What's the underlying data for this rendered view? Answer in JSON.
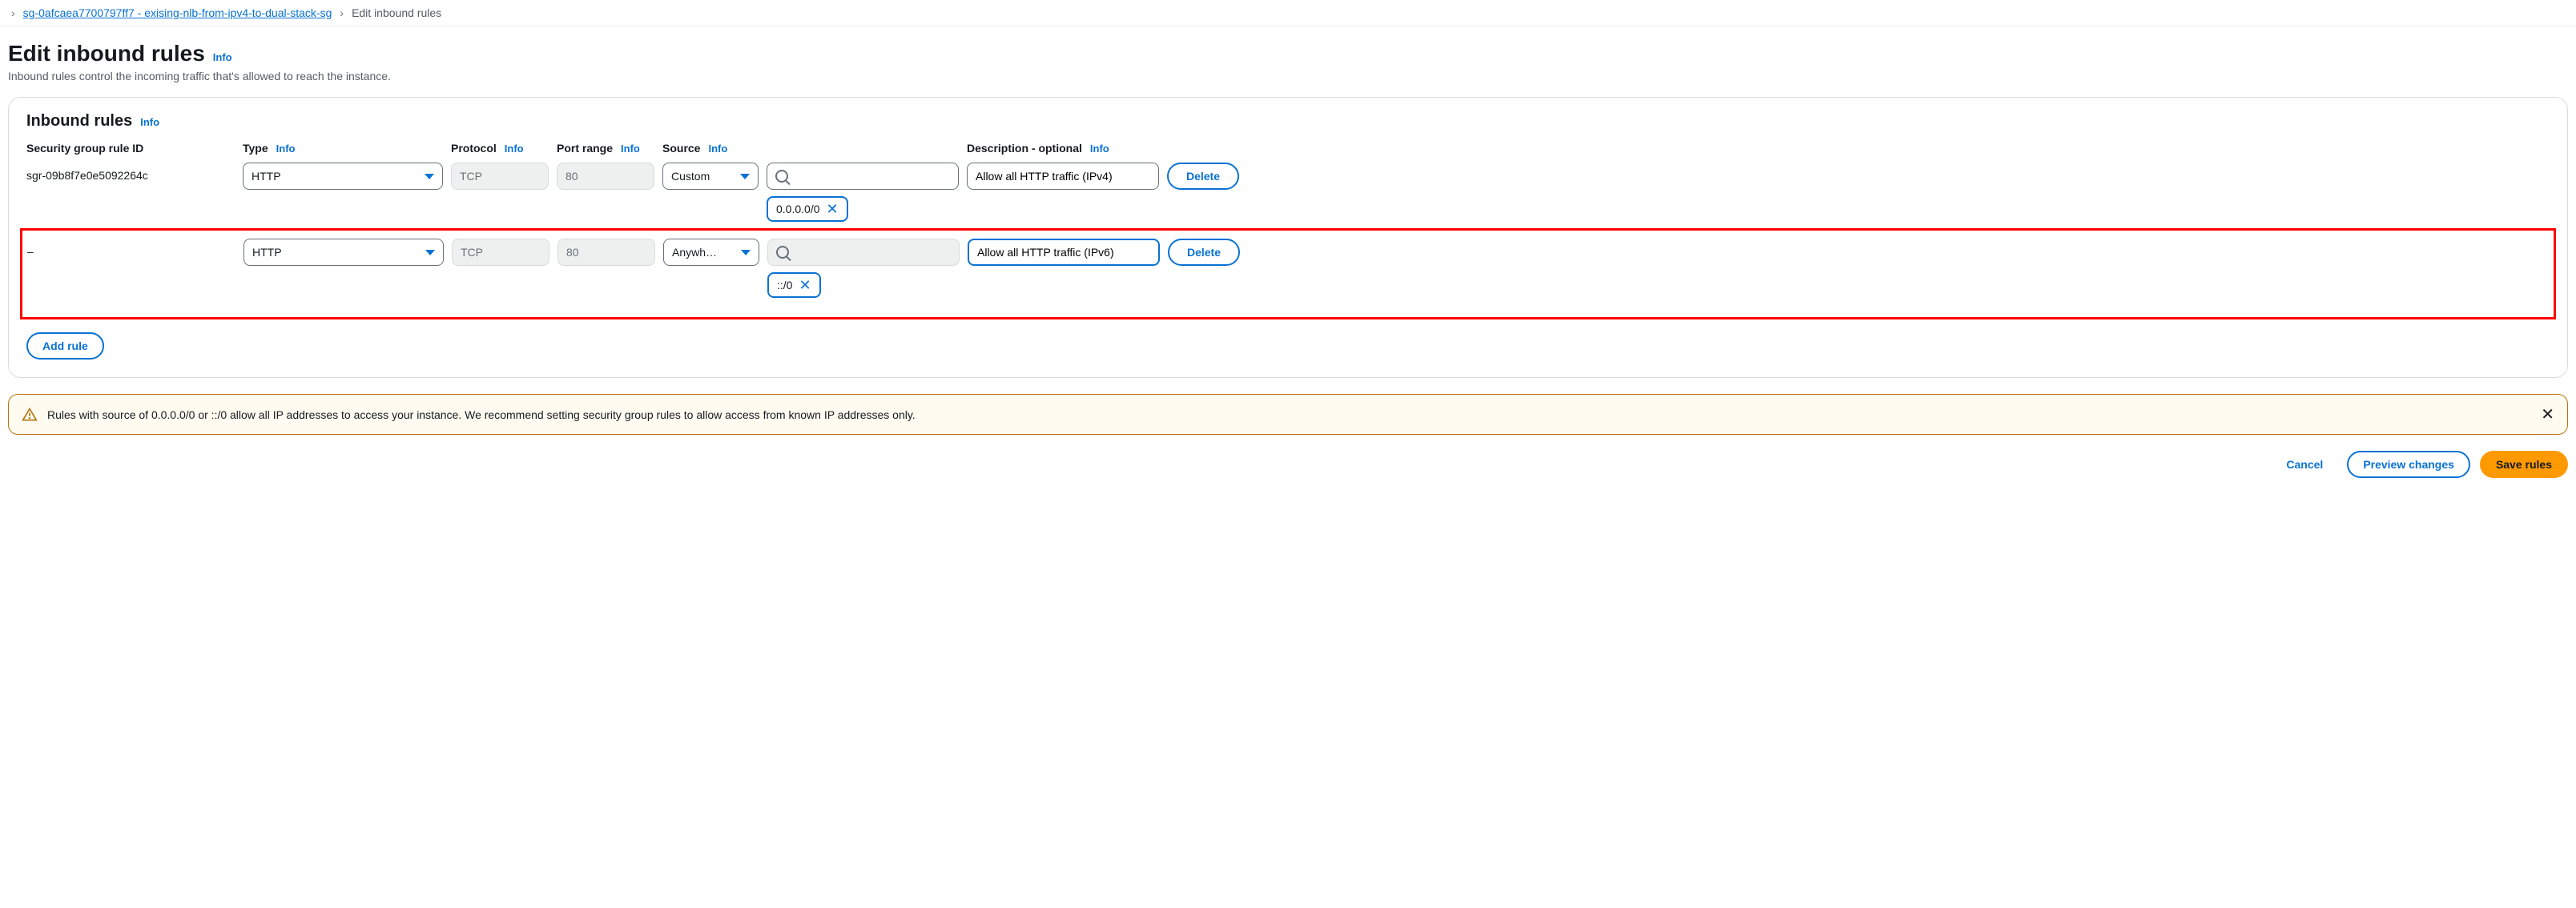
{
  "breadcrumb": {
    "link_text": "sg-0afcaea7700797ff7 - exising-nlb-from-ipv4-to-dual-stack-sg",
    "current": "Edit inbound rules"
  },
  "page": {
    "title": "Edit inbound rules",
    "info": "Info",
    "subtitle": "Inbound rules control the incoming traffic that's allowed to reach the instance."
  },
  "panel": {
    "title": "Inbound rules",
    "info": "Info",
    "headers": {
      "rule_id": "Security group rule ID",
      "type": "Type",
      "protocol": "Protocol",
      "port": "Port range",
      "source": "Source",
      "desc": "Description - optional",
      "info": "Info"
    },
    "rules": [
      {
        "id": "sgr-09b8f7e0e5092264c",
        "type": "HTTP",
        "protocol": "TCP",
        "port": "80",
        "source_mode": "Custom",
        "source_token": "0.0.0.0/0",
        "description": "Allow all HTTP traffic (IPv4)",
        "delete": "Delete"
      },
      {
        "id": "–",
        "type": "HTTP",
        "protocol": "TCP",
        "port": "80",
        "source_mode": "Anywh…",
        "source_token": "::/0",
        "description": "Allow all HTTP traffic (IPv6)",
        "delete": "Delete"
      }
    ],
    "add_rule": "Add rule"
  },
  "alert": {
    "message": "Rules with source of 0.0.0.0/0 or ::/0 allow all IP addresses to access your instance. We recommend setting security group rules to allow access from known IP addresses only."
  },
  "footer": {
    "cancel": "Cancel",
    "preview": "Preview changes",
    "save": "Save rules"
  }
}
